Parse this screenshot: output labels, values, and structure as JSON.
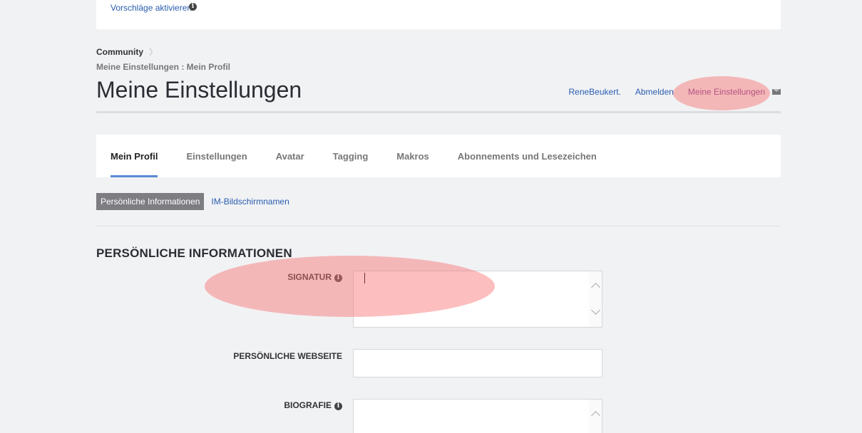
{
  "top_panel": {
    "activate_label": "Vorschläge aktivieren"
  },
  "breadcrumb": {
    "root": "Community",
    "sub": "Meine Einstellungen : Mein Profil"
  },
  "page_title": "Meine Einstellungen",
  "user_nav": {
    "username": "ReneBeukert.",
    "logout": "Abmelden",
    "settings": "Meine Einstellungen"
  },
  "tabs": [
    {
      "label": "Mein Profil"
    },
    {
      "label": "Einstellungen"
    },
    {
      "label": "Avatar"
    },
    {
      "label": "Tagging"
    },
    {
      "label": "Makros"
    },
    {
      "label": "Abonnements und Lesezeichen"
    }
  ],
  "subtabs": {
    "active": "Persönliche Informationen",
    "link": "IM-Bildschirmnamen"
  },
  "section": {
    "heading": "PERSÖNLICHE INFORMATIONEN",
    "fields": {
      "signature": "SIGNATUR",
      "website": "PERSÖNLICHE WEBSEITE",
      "biography": "BIOGRAFIE"
    }
  },
  "colors": {
    "accent": "#5b8ad6",
    "link": "#2a5db0",
    "visited_link": "#7a3a8f",
    "highlight": "#f86e6e"
  }
}
